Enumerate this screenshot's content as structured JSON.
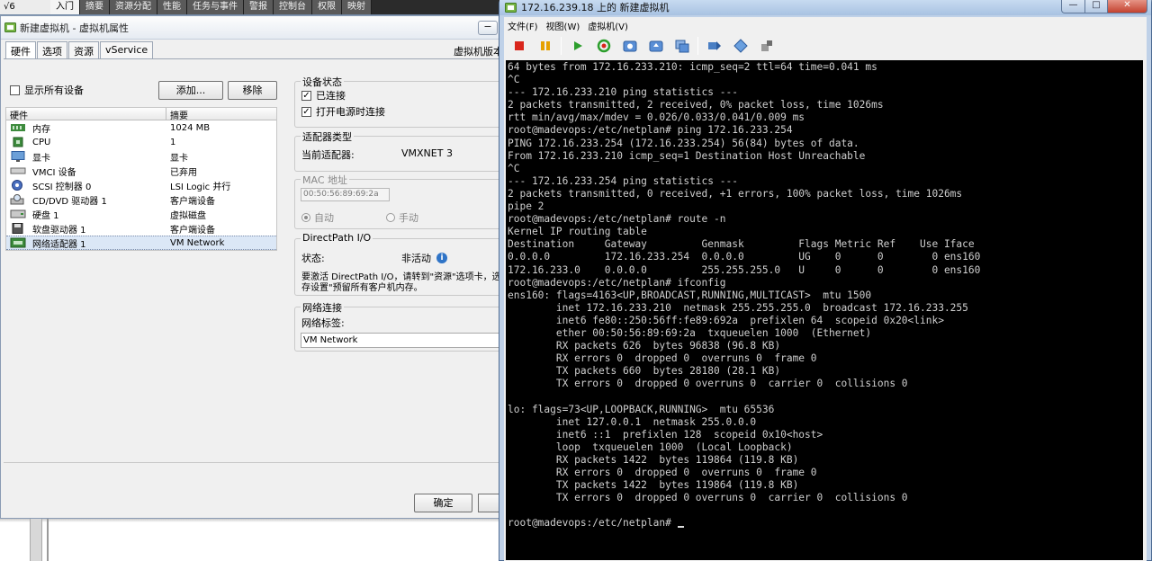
{
  "background": {
    "left_label": "√6",
    "tabs": [
      "入门",
      "摘要",
      "资源分配",
      "性能",
      "任务与事件",
      "警报",
      "控制台",
      "权限",
      "映射"
    ],
    "active_tab": 0
  },
  "props": {
    "title": "新建虚拟机 - 虚拟机属性",
    "minimize_glyph": "−",
    "tabs": [
      "硬件",
      "选项",
      "资源",
      "vService"
    ],
    "version_label": "虚拟机版本",
    "show_all_label": "显示所有设备",
    "add_label": "添加...",
    "remove_label": "移除",
    "table": {
      "col_hw": "硬件",
      "col_summary": "摘要",
      "rows": [
        {
          "name": "内存",
          "summary": "1024 MB",
          "icon": "memory-icon"
        },
        {
          "name": "CPU",
          "summary": "1",
          "icon": "cpu-icon"
        },
        {
          "name": "显卡",
          "summary": "显卡",
          "icon": "display-icon"
        },
        {
          "name": "VMCI 设备",
          "summary": "已弃用",
          "icon": "vmci-icon"
        },
        {
          "name": "SCSI 控制器 0",
          "summary": "LSI Logic 并行",
          "icon": "scsi-icon"
        },
        {
          "name": "CD/DVD 驱动器 1",
          "summary": "客户端设备",
          "icon": "cdrom-icon"
        },
        {
          "name": "硬盘 1",
          "summary": "虚拟磁盘",
          "icon": "disk-icon"
        },
        {
          "name": "软盘驱动器 1",
          "summary": "客户端设备",
          "icon": "floppy-icon"
        },
        {
          "name": "网络适配器 1",
          "summary": "VM Network",
          "icon": "nic-icon"
        }
      ],
      "selected_index": 8
    },
    "device_status": {
      "title": "设备状态",
      "connected_label": "已连接",
      "connected": true,
      "connect_on_power_label": "打开电源时连接",
      "connect_on_power": true
    },
    "adapter_type": {
      "title": "适配器类型",
      "current_label": "当前适配器:",
      "current_value": "VMXNET 3"
    },
    "mac": {
      "title": "MAC 地址",
      "value": "00:50:56:89:69:2a",
      "auto_label": "自动",
      "manual_label": "手动",
      "mode": "auto"
    },
    "directpath": {
      "title": "DirectPath I/O",
      "status_label": "状态:",
      "status_value": "非活动",
      "desc_line1": "要激活 DirectPath I/O，请转到\"资源\"选项卡，选",
      "desc_line2": "存设置\"预留所有客户机内存。"
    },
    "network": {
      "title": "网络连接",
      "label": "网络标签:",
      "value": "VM Network"
    },
    "ok_label": "确定"
  },
  "console": {
    "title": "172.16.239.18 上的 新建虚拟机",
    "menu": [
      "文件(F)",
      "视图(W)",
      "虚拟机(V)"
    ],
    "toolbar": [
      "power-off-icon",
      "suspend-icon",
      "power-on-icon",
      "reset-icon",
      "snapshot-icon",
      "revert-snapshot-icon",
      "manage-snapshots-icon",
      "connect-cd-icon",
      "connect-floppy-icon",
      "vm-settings-icon"
    ],
    "terminal_lines": [
      "64 bytes from 172.16.233.210: icmp_seq=2 ttl=64 time=0.041 ms",
      "^C",
      "--- 172.16.233.210 ping statistics ---",
      "2 packets transmitted, 2 received, 0% packet loss, time 1026ms",
      "rtt min/avg/max/mdev = 0.026/0.033/0.041/0.009 ms",
      "root@madevops:/etc/netplan# ping 172.16.233.254",
      "PING 172.16.233.254 (172.16.233.254) 56(84) bytes of data.",
      "From 172.16.233.210 icmp_seq=1 Destination Host Unreachable",
      "^C",
      "--- 172.16.233.254 ping statistics ---",
      "2 packets transmitted, 0 received, +1 errors, 100% packet loss, time 1026ms",
      "pipe 2",
      "root@madevops:/etc/netplan# route -n",
      "Kernel IP routing table",
      "Destination     Gateway         Genmask         Flags Metric Ref    Use Iface",
      "0.0.0.0         172.16.233.254  0.0.0.0         UG    0      0        0 ens160",
      "172.16.233.0    0.0.0.0         255.255.255.0   U     0      0        0 ens160",
      "root@madevops:/etc/netplan# ifconfig",
      "ens160: flags=4163<UP,BROADCAST,RUNNING,MULTICAST>  mtu 1500",
      "        inet 172.16.233.210  netmask 255.255.255.0  broadcast 172.16.233.255",
      "        inet6 fe80::250:56ff:fe89:692a  prefixlen 64  scopeid 0x20<link>",
      "        ether 00:50:56:89:69:2a  txqueuelen 1000  (Ethernet)",
      "        RX packets 626  bytes 96838 (96.8 KB)",
      "        RX errors 0  dropped 0  overruns 0  frame 0",
      "        TX packets 660  bytes 28180 (28.1 KB)",
      "        TX errors 0  dropped 0 overruns 0  carrier 0  collisions 0",
      "",
      "lo: flags=73<UP,LOOPBACK,RUNNING>  mtu 65536",
      "        inet 127.0.0.1  netmask 255.0.0.0",
      "        inet6 ::1  prefixlen 128  scopeid 0x10<host>",
      "        loop  txqueuelen 1000  (Local Loopback)",
      "        RX packets 1422  bytes 119864 (119.8 KB)",
      "        RX errors 0  dropped 0  overruns 0  frame 0",
      "        TX packets 1422  bytes 119864 (119.8 KB)",
      "        TX errors 0  dropped 0 overruns 0  carrier 0  collisions 0",
      "",
      "root@madevops:/etc/netplan# "
    ]
  }
}
